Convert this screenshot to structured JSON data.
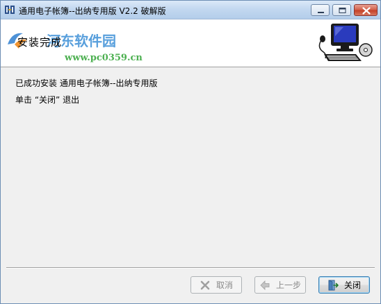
{
  "window": {
    "title": "通用电子帐簿--出纳专用版 V2.2 破解版"
  },
  "header": {
    "title": "安装完成"
  },
  "watermark": {
    "site_name": "河东软件园",
    "url": "www.pc0359.cn"
  },
  "content": {
    "line1": "已成功安装 通用电子帐簿--出纳专用版",
    "line2": "单击 “关闭” 退出"
  },
  "buttons": {
    "cancel": {
      "label": "取消",
      "enabled": false,
      "icon": "x-icon"
    },
    "back": {
      "label": "上一步",
      "enabled": false,
      "icon": "arrow-left-icon"
    },
    "close": {
      "label": "关闭",
      "enabled": true,
      "icon": "exit-door-icon"
    }
  },
  "colors": {
    "titlebar": "#c3d8f0",
    "close_caption": "#c44128",
    "watermark_blue": "#3c8fd6",
    "watermark_green": "#3aa83f",
    "default_button_border": "#3c7fb1"
  }
}
